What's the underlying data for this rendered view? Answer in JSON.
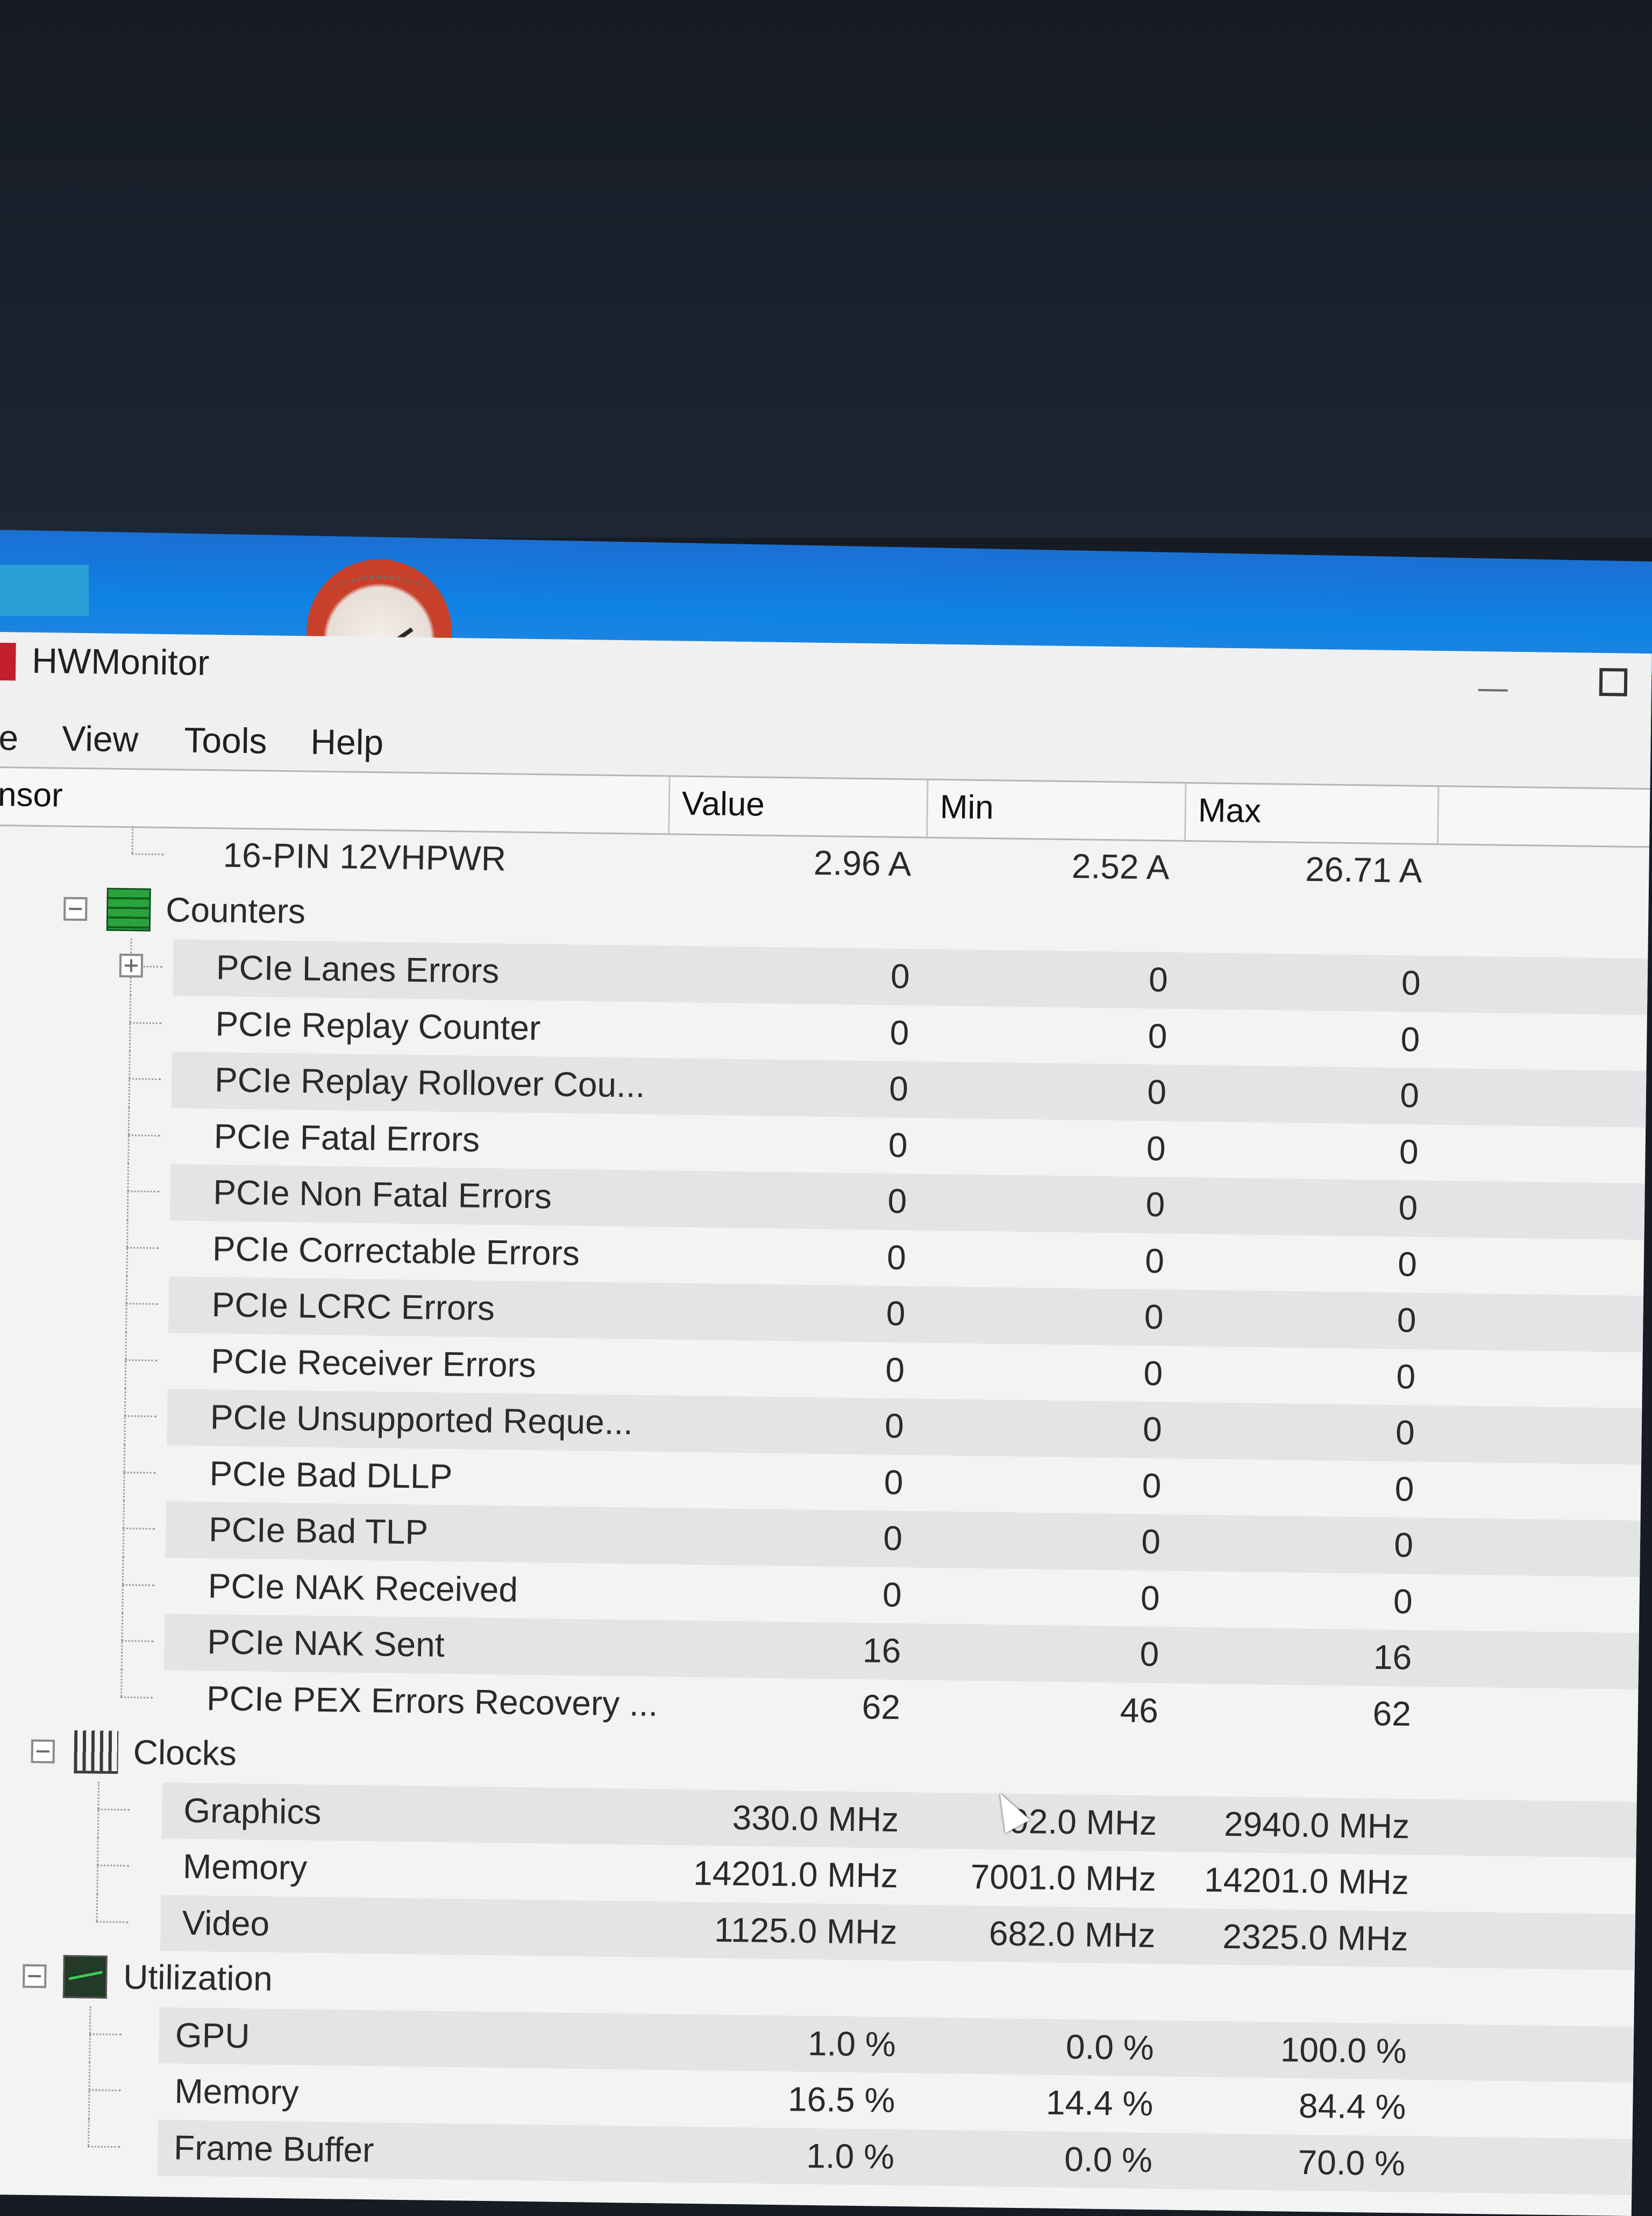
{
  "window": {
    "title": "HWMonitor"
  },
  "menu": [
    "e",
    "View",
    "Tools",
    "Help"
  ],
  "columns": {
    "sensor": "nsor",
    "value": "Value",
    "min": "Min",
    "max": "Max"
  },
  "prev_row": {
    "name": "16-PIN 12VHPWR",
    "value": "2.96 A",
    "min": "2.52 A",
    "max": "26.71 A"
  },
  "groups": {
    "counters": {
      "label": "Counters",
      "rows": [
        {
          "name": "PCIe Lanes Errors",
          "value": "0",
          "min": "0",
          "max": "0"
        },
        {
          "name": "PCIe Replay Counter",
          "value": "0",
          "min": "0",
          "max": "0"
        },
        {
          "name": "PCIe Replay Rollover Cou...",
          "value": "0",
          "min": "0",
          "max": "0"
        },
        {
          "name": "PCIe Fatal Errors",
          "value": "0",
          "min": "0",
          "max": "0"
        },
        {
          "name": "PCIe Non Fatal Errors",
          "value": "0",
          "min": "0",
          "max": "0"
        },
        {
          "name": "PCIe Correctable Errors",
          "value": "0",
          "min": "0",
          "max": "0"
        },
        {
          "name": "PCIe LCRC Errors",
          "value": "0",
          "min": "0",
          "max": "0"
        },
        {
          "name": "PCIe Receiver Errors",
          "value": "0",
          "min": "0",
          "max": "0"
        },
        {
          "name": "PCIe Unsupported Reque...",
          "value": "0",
          "min": "0",
          "max": "0"
        },
        {
          "name": "PCIe Bad DLLP",
          "value": "0",
          "min": "0",
          "max": "0"
        },
        {
          "name": "PCIe Bad TLP",
          "value": "0",
          "min": "0",
          "max": "0"
        },
        {
          "name": "PCIe NAK Received",
          "value": "0",
          "min": "0",
          "max": "0"
        },
        {
          "name": "PCIe NAK Sent",
          "value": "16",
          "min": "0",
          "max": "16"
        },
        {
          "name": "PCIe PEX Errors Recovery ...",
          "value": "62",
          "min": "46",
          "max": "62"
        }
      ]
    },
    "clocks": {
      "label": "Clocks",
      "rows": [
        {
          "name": "Graphics",
          "value": "330.0 MHz",
          "min": "​92.0 MHz",
          "max": "2940.0 MHz"
        },
        {
          "name": "Memory",
          "value": "14201.0 MHz",
          "min": "7001.0 MHz",
          "max": "14201.0 MHz"
        },
        {
          "name": "Video",
          "value": "1125.0 MHz",
          "min": "682.0 MHz",
          "max": "2325.0 MHz"
        }
      ]
    },
    "utilization": {
      "label": "Utilization",
      "rows": [
        {
          "name": "GPU",
          "value": "1.0 %",
          "min": "0.0 %",
          "max": "100.0 %"
        },
        {
          "name": "Memory",
          "value": "16.5 %",
          "min": "14.4 %",
          "max": "84.4 %"
        },
        {
          "name": "Frame Buffer",
          "value": "1.0 %",
          "min": "0.0 %",
          "max": "70.0 %"
        }
      ]
    }
  },
  "icons": {
    "counters": "counters-icon",
    "clocks": "clocks-icon",
    "utilization": "utilization-icon",
    "app": "hwmonitor-gauge-icon"
  },
  "colors": {
    "taskbar": "#1b6fd2",
    "row_shade": "#e4e4e7",
    "counters_icon": "#2aa33c"
  }
}
